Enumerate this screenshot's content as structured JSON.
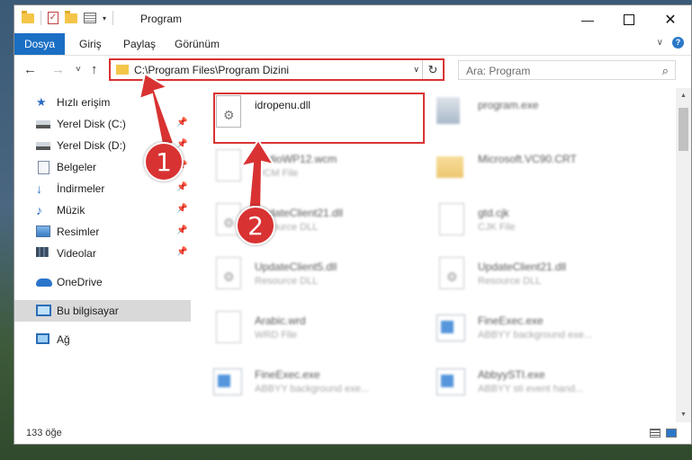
{
  "window": {
    "title": "Program",
    "controls": {
      "minimize": "—",
      "close": "✕"
    }
  },
  "ribbon": {
    "tabs": [
      "Dosya",
      "Giriş",
      "Paylaş",
      "Görünüm"
    ],
    "expand": "∨",
    "help": "?"
  },
  "nav": {
    "back": "←",
    "forward": "→",
    "recent": "˅",
    "up": "↑",
    "address": "C:\\Program Files\\Program Dizini",
    "address_drop": "∨",
    "refresh": "↻",
    "search_placeholder": "Ara: Program",
    "search_icon": "⌕"
  },
  "sidebar": {
    "items": [
      {
        "label": "Hızlı erişim",
        "icon": "quick-access-star-icon"
      },
      {
        "label": "Yerel Disk (C:)",
        "icon": "drive-icon",
        "pinned": true
      },
      {
        "label": "Yerel Disk (D:)",
        "icon": "drive-icon",
        "pinned": true
      },
      {
        "label": "Belgeler",
        "icon": "documents-icon",
        "pinned": true
      },
      {
        "label": "İndirmeler",
        "icon": "downloads-icon",
        "pinned": true
      },
      {
        "label": "Müzik",
        "icon": "music-icon",
        "pinned": true
      },
      {
        "label": "Resimler",
        "icon": "pictures-icon",
        "pinned": true
      },
      {
        "label": "Videolar",
        "icon": "videos-icon",
        "pinned": true
      },
      {
        "label": "OneDrive",
        "icon": "onedrive-icon"
      },
      {
        "label": "Bu bilgisayar",
        "icon": "this-pc-icon",
        "selected": true
      },
      {
        "label": "Ağ",
        "icon": "network-icon"
      }
    ],
    "pin_glyph": "📌"
  },
  "files": [
    {
      "name": "idropenu.dll",
      "type": "",
      "icon": "dll-file-icon",
      "highlighted": true
    },
    {
      "name": "program.exe",
      "type": "",
      "icon": "exe-file-icon"
    },
    {
      "name": "AudioWP12.wcm",
      "type": "WCM File",
      "icon": "file-icon"
    },
    {
      "name": "Microsoft.VC90.CRT",
      "type": "",
      "icon": "folder-icon"
    },
    {
      "name": "UpdateClient21.dll",
      "type": "Resource DLL",
      "icon": "dll-file-icon"
    },
    {
      "name": "gtd.cjk",
      "type": "CJK File",
      "icon": "file-icon"
    },
    {
      "name": "UpdateClient5.dll",
      "type": "Resource DLL",
      "icon": "dll-file-icon"
    },
    {
      "name": "UpdateClient21.dll",
      "type": "Resource DLL",
      "icon": "dll-file-icon"
    },
    {
      "name": "Arabic.wrd",
      "type": "WRD File",
      "icon": "file-icon"
    },
    {
      "name": "FineExec.exe",
      "type": "ABBYY background exe...",
      "icon": "app-icon"
    },
    {
      "name": "FineExec.exe",
      "type": "ABBYY background exe...",
      "icon": "app-icon"
    },
    {
      "name": "AbbyySTI.exe",
      "type": "ABBYY sti event hand...",
      "icon": "app-icon"
    }
  ],
  "status": {
    "count": "133 öğe"
  },
  "callouts": [
    "1",
    "2"
  ],
  "colors": {
    "accent": "#1a6fc4",
    "annotation_red": "#d93232"
  }
}
